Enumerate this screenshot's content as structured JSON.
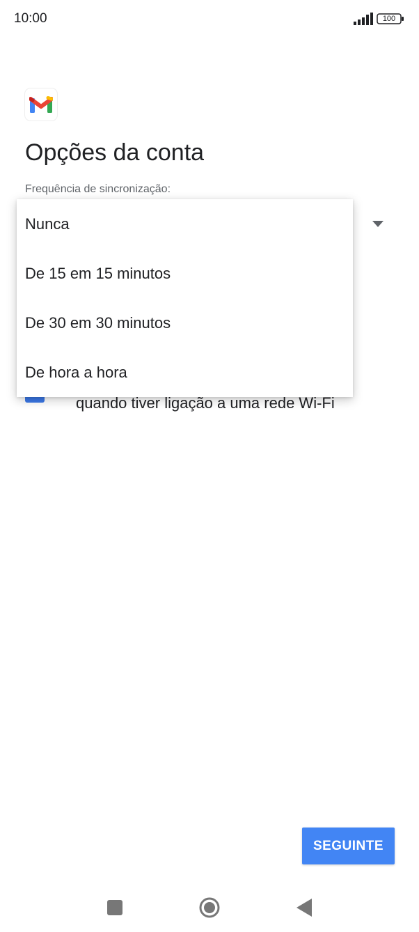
{
  "status_bar": {
    "time": "10:00",
    "battery": "100",
    "icons": [
      "signal-icon",
      "battery-icon"
    ]
  },
  "app": {
    "logo_icon": "gmail-logo-icon",
    "colors": {
      "blue": "#4285f4",
      "red": "#ea4335",
      "yellow": "#fbbc04",
      "green": "#34a853"
    }
  },
  "page": {
    "title": "Opções da conta",
    "sync_label": "Frequência de sincronização:",
    "wifi_option_text": "quando tiver ligação a uma rede Wi-Fi"
  },
  "dropdown": {
    "options": [
      {
        "label": "Nunca"
      },
      {
        "label": "De 15 em 15 minutos"
      },
      {
        "label": "De 30 em 30 minutos"
      },
      {
        "label": "De hora a hora"
      }
    ]
  },
  "actions": {
    "next_label": "SEGUINTE",
    "accent_color": "#4285f4"
  },
  "nav_bar": {
    "icons": [
      "recents-icon",
      "home-icon",
      "back-icon"
    ]
  }
}
